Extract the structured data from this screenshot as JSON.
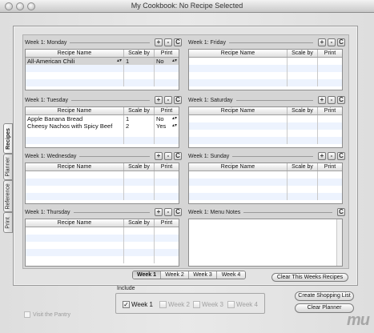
{
  "window": {
    "title": "My Cookbook: No Recipe Selected"
  },
  "side_tabs": [
    "Recipes",
    "Planner",
    "Reference",
    "Print"
  ],
  "columns": {
    "name": "Recipe Name",
    "scale": "Scale by",
    "print": "Print"
  },
  "buttons": {
    "add": "+",
    "remove": "-",
    "clear": "C"
  },
  "days": {
    "monday": {
      "title": "Week 1: Monday",
      "rows": [
        {
          "name": "All-American Chili",
          "scale": "1",
          "print": "No"
        }
      ]
    },
    "tuesday": {
      "title": "Week 1: Tuesday",
      "rows": [
        {
          "name": "Apple Banana Bread",
          "scale": "1",
          "print": "No"
        },
        {
          "name": "Cheesy Nachos with Spicy Beef",
          "scale": "2",
          "print": "Yes"
        }
      ]
    },
    "wednesday": {
      "title": "Week 1: Wednesday"
    },
    "thursday": {
      "title": "Week 1: Thursday"
    },
    "friday": {
      "title": "Week 1: Friday"
    },
    "saturday": {
      "title": "Week 1: Saturday"
    },
    "sunday": {
      "title": "Week 1: Sunday"
    },
    "notes": {
      "title": "Week 1: Menu Notes"
    }
  },
  "clear_week_button": "Clear This Weeks Recipes",
  "week_tabs": [
    "Week 1",
    "Week 2",
    "Week 3",
    "Week 4"
  ],
  "include": {
    "label": "Include",
    "options": [
      {
        "label": "Week 1",
        "checked": true
      },
      {
        "label": "Week 2",
        "checked": false
      },
      {
        "label": "Week 3",
        "checked": false
      },
      {
        "label": "Week 4",
        "checked": false
      }
    ]
  },
  "pantry_label": "Visit the Pantry",
  "create_shopping_list": "Create Shopping List",
  "clear_planner": "Clear Planner",
  "check_mark": "✓",
  "watermark": "mu"
}
